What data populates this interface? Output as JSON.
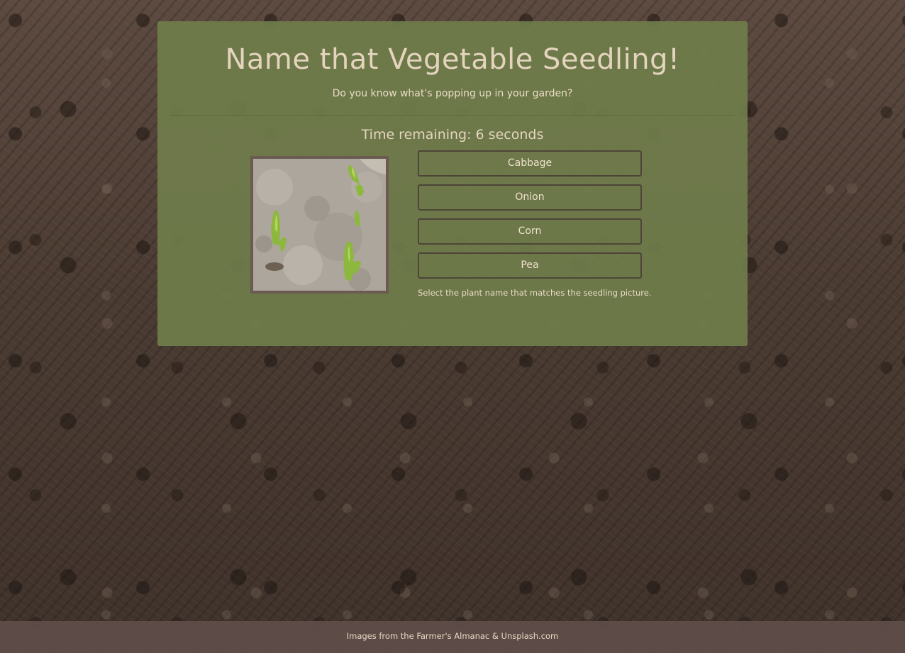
{
  "quiz": {
    "title": "Name that Vegetable Seedling!",
    "subtitle": "Do you know what's popping up in your garden?",
    "timer": "Time remaining: 6 seconds",
    "choices": [
      {
        "label": "Cabbage"
      },
      {
        "label": "Onion"
      },
      {
        "label": "Corn"
      },
      {
        "label": "Pea"
      }
    ],
    "hint": "Select the plant name that matches the seedling picture."
  },
  "footer": {
    "credit": "Images from the Farmer's Almanac & Unsplash.com"
  },
  "colors": {
    "panel": "#707d4b",
    "text": "#e4d4bd",
    "button_border": "#4d4538",
    "image_border": "#6b5a50",
    "footer": "#5f4e48",
    "soil": "#4a3b32"
  }
}
